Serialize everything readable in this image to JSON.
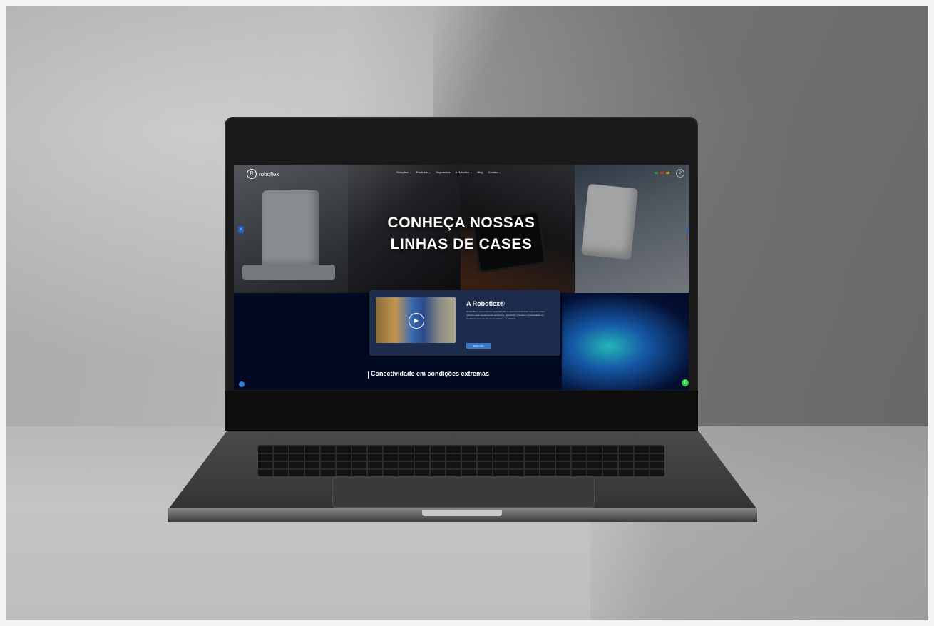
{
  "site": {
    "logo_text": "roboflex",
    "menu": [
      "Soluções ⌄",
      "Produtos ⌄",
      "Segmentos",
      "A Roboflex ⌄",
      "Blog",
      "Contato ⌄"
    ],
    "search_icon": "search-icon"
  },
  "hero": {
    "title_line1": "CONHEÇA NOSSAS",
    "title_line2": "LINHAS DE CASES",
    "prev_label": "‹",
    "next_label": "›"
  },
  "about_card": {
    "title": "A Roboflex®",
    "text": "A Roboflex é uma empresa especializada no desenvolvimento de suportes e cases robustos para equipamentos eletrônicos, garantindo proteção e conectividade em condições extremas de uso no campo e na indústria.",
    "button_label": "Saiba mais",
    "play_icon": "▶"
  },
  "section": {
    "title": "Conectividade em condições extremas"
  },
  "colors": {
    "accent": "#3a78c8",
    "screen_bg": "#020a22",
    "whatsapp": "#2ecc40"
  }
}
